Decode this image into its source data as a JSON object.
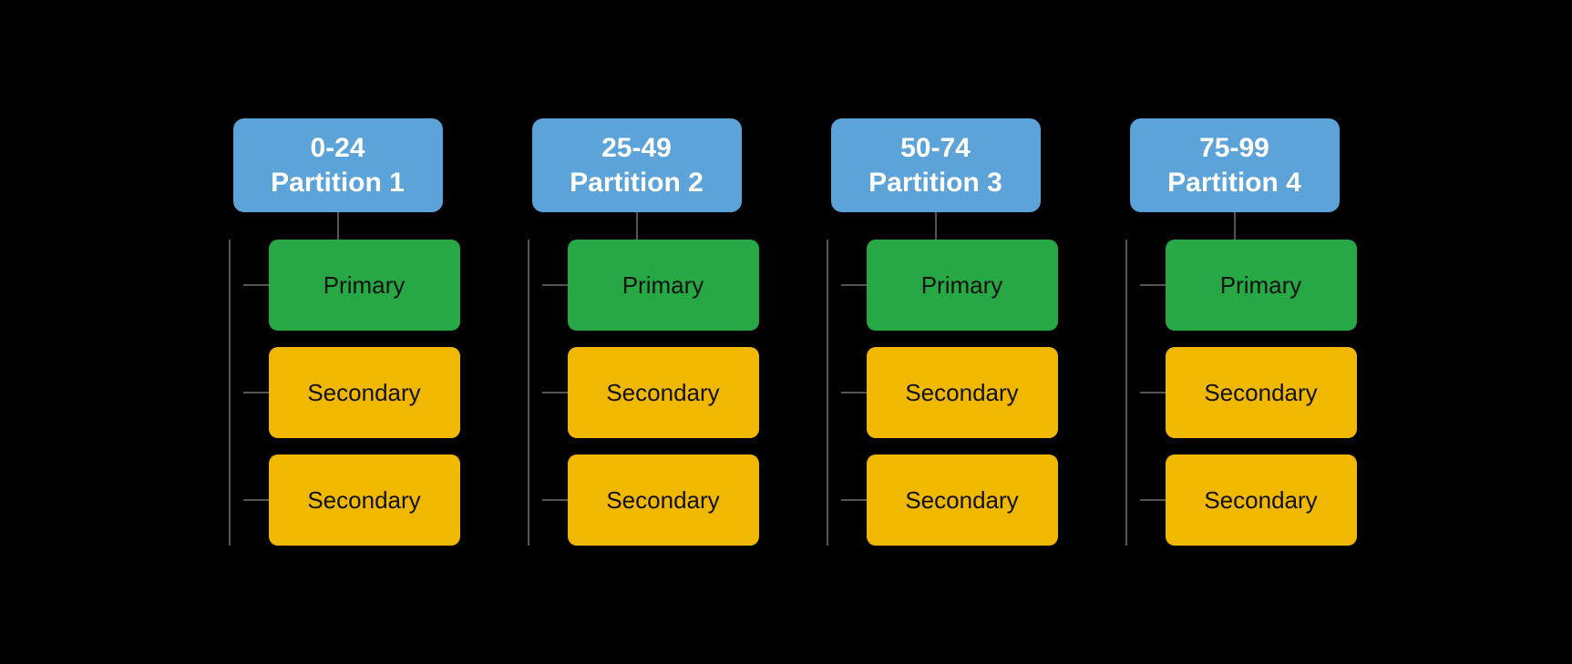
{
  "diagram": {
    "partitions": [
      {
        "id": "p1",
        "range": "0-24",
        "label": "Partition 1",
        "primary_label": "Primary",
        "secondary_labels": [
          "Secondary",
          "Secondary"
        ]
      },
      {
        "id": "p2",
        "range": "25-49",
        "label": "Partition 2",
        "primary_label": "Primary",
        "secondary_labels": [
          "Secondary",
          "Secondary"
        ]
      },
      {
        "id": "p3",
        "range": "50-74",
        "label": "Partition 3",
        "primary_label": "Primary",
        "secondary_labels": [
          "Secondary",
          "Secondary"
        ]
      },
      {
        "id": "p4",
        "range": "75-99",
        "label": "Partition 4",
        "primary_label": "Primary",
        "secondary_labels": [
          "Secondary",
          "Secondary"
        ]
      }
    ]
  },
  "colors": {
    "header_bg": "#5ba3d9",
    "primary_bg": "#27a844",
    "secondary_bg": "#f0b800",
    "line_color": "#555"
  }
}
